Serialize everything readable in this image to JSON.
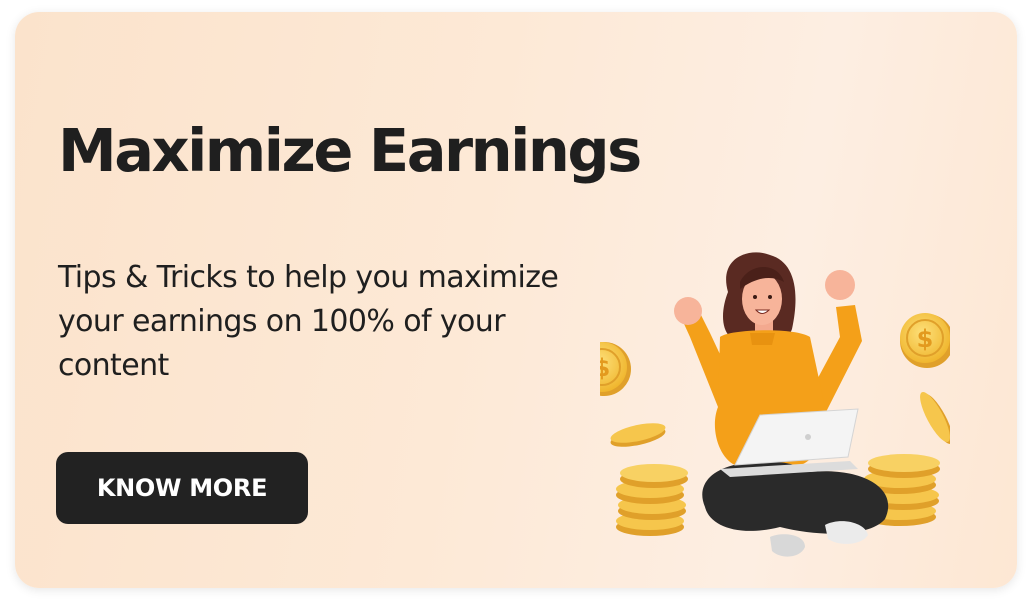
{
  "banner": {
    "title": "Maximize Earnings",
    "subtitle": "Tips & Tricks to help you maximize your earnings on 100% of your content",
    "cta_label": "KNOW MORE"
  },
  "illustration": {
    "subject": "woman-with-laptop-and-coins",
    "coin_symbol": "$"
  },
  "colors": {
    "card_start": "#fbe3cc",
    "card_end": "#fde7d3",
    "text": "#1f1f1f",
    "button": "#222222",
    "button_text": "#ffffff",
    "sweater": "#f4a019",
    "coin": "#f4c54a"
  }
}
